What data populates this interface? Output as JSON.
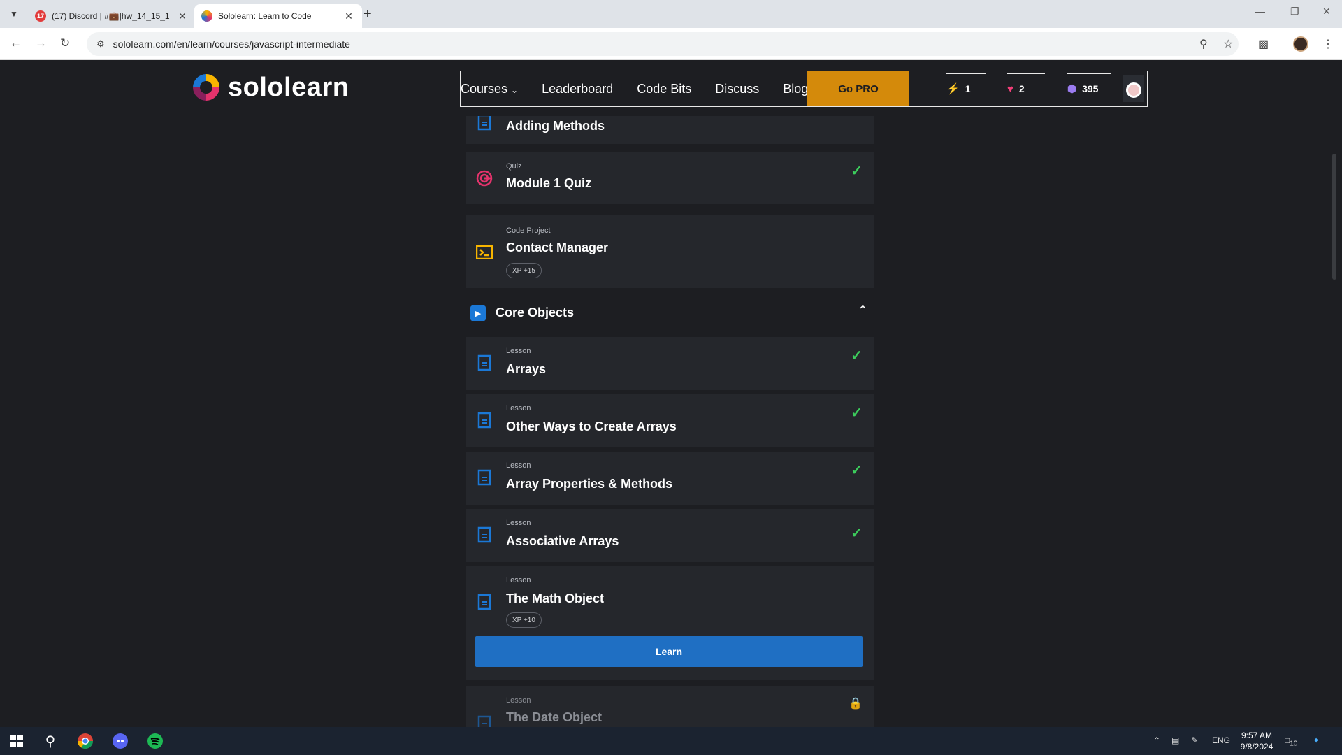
{
  "browser": {
    "tabs": [
      {
        "title": "(17) Discord | #💼|hw_14_15_1",
        "favicon_badge": "17"
      },
      {
        "title": "Sololearn: Learn to Code"
      }
    ],
    "url": "sololearn.com/en/learn/courses/javascript-intermediate"
  },
  "site": {
    "logo_text": "sololearn",
    "nav": [
      "Courses",
      "Leaderboard",
      "Code Bits",
      "Discuss",
      "Blog"
    ],
    "go_pro": "Go PRO",
    "stats": {
      "streak": "1",
      "hearts": "2",
      "gems": "395"
    }
  },
  "course": {
    "items_top": [
      {
        "name": "Adding Methods"
      },
      {
        "type": "Quiz",
        "name": "Module 1 Quiz",
        "completed": true
      },
      {
        "type": "Code Project",
        "name": "Contact Manager",
        "xp": "XP +15"
      }
    ],
    "section_title": "Core Objects",
    "lessons": [
      {
        "type": "Lesson",
        "name": "Arrays",
        "completed": true
      },
      {
        "type": "Lesson",
        "name": "Other Ways to Create Arrays",
        "completed": true
      },
      {
        "type": "Lesson",
        "name": "Array Properties & Methods",
        "completed": true
      },
      {
        "type": "Lesson",
        "name": "Associative Arrays",
        "completed": true
      },
      {
        "type": "Lesson",
        "name": "The Math Object",
        "xp": "XP +10"
      },
      {
        "type": "Lesson",
        "name": "The Date Object",
        "locked": true
      }
    ],
    "learn_button": "Learn"
  },
  "taskbar": {
    "language": "ENG",
    "time": "9:57 AM",
    "date": "9/8/2024",
    "notifications": "10"
  },
  "colors": {
    "accent_blue": "#1f6fc3",
    "go_pro": "#d48a0b",
    "check_green": "#3ccd5c",
    "background": "#1d1e22",
    "card": "#25272c"
  }
}
